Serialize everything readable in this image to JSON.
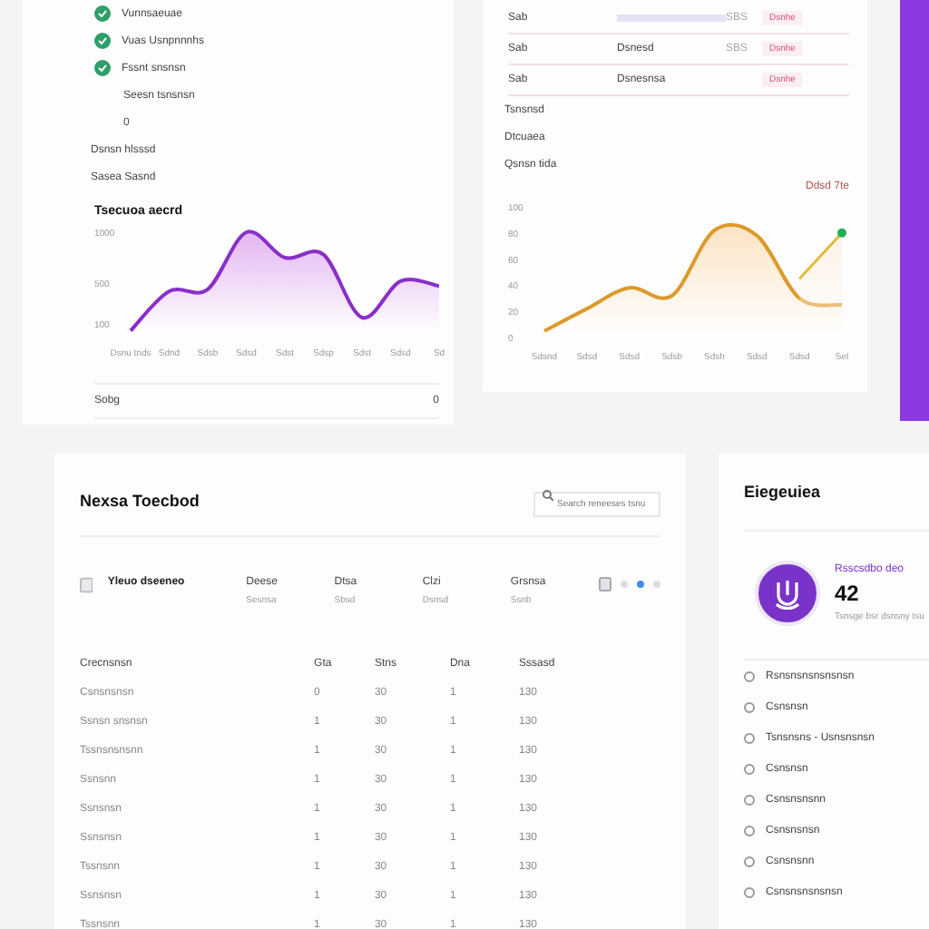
{
  "status_card": {
    "checks": [
      {
        "label": "Vunnsaeuae",
        "done": true
      },
      {
        "label": "Vuas Usnpnnnhs",
        "done": true
      },
      {
        "label": "Fssnt snsnsn",
        "done": true
      }
    ],
    "lines": [
      "Seesn tsnsnsn",
      "0",
      "Dsnsn hlsssd",
      "Sasea Sasnd"
    ],
    "chart": {
      "chart_data": {
        "type": "area",
        "title": "Tsecuoa aecrd",
        "categories": [
          "Dsnu tnds",
          "Sdnd",
          "Sdsb",
          "Sdsd",
          "Sdst",
          "Sdsp",
          "Sdst",
          "Sdsd",
          "Sd"
        ],
        "ylim": [
          0,
          1000
        ],
        "yticks": [
          100,
          500,
          1000
        ],
        "series": [
          {
            "color": "#8a2fc8",
            "values": [
              30,
              420,
              440,
              1000,
              750,
              780,
              160,
              520,
              470
            ]
          }
        ]
      }
    },
    "footer": {
      "label": "Sobg",
      "value": "0"
    }
  },
  "trend_card": {
    "rows": [
      {
        "column_1": "Sab",
        "column_3": "SBS",
        "tag": "Dsnhe"
      },
      {
        "column_1": "Sab",
        "column_2": "Dsnesd",
        "column_3": "SBS",
        "tag": "Dsnhe"
      },
      {
        "column_1": "Sab",
        "column_2": "Dsnesnsa",
        "tag": "Dsnhe"
      }
    ],
    "lines": [
      "Tsnsnsd",
      "Dtcuaea",
      "Qsnsn tida"
    ],
    "chart": {
      "chart_data": {
        "type": "area",
        "categories": [
          "Sdsnd",
          "Sdsd",
          "Sdsd",
          "Sdsb",
          "Sdsh",
          "Sdsd",
          "Sdsd",
          "Sel"
        ],
        "ylim": [
          0,
          100
        ],
        "yticks": [
          0,
          20,
          40,
          60,
          80,
          100
        ],
        "series": [
          {
            "name": "Ddsd 7te",
            "color": "#dd9a2a",
            "values": [
              5,
              22,
              38,
              32,
              82,
              78,
              30,
              25
            ]
          },
          {
            "color": "#e5b93a",
            "values": [
              null,
              null,
              null,
              null,
              null,
              null,
              45,
              80
            ]
          }
        ]
      }
    }
  },
  "table_card": {
    "title": "Nexsa Toecbod",
    "search": {
      "placeholder": "Search reneeses tsnu"
    },
    "summary": {
      "title": "Yleuo dseeneo",
      "stats": [
        {
          "label": "Deese",
          "value": "Sesnsa"
        },
        {
          "label": "Dtsa",
          "value": "Sbsd"
        },
        {
          "label": "Clzi",
          "value": "Dsnsd"
        },
        {
          "label": "Grsnsa",
          "value": "Ssnb"
        }
      ],
      "pages": [
        {
          "selected": false
        },
        {
          "selected": true
        },
        {
          "selected": false
        }
      ]
    },
    "columns": [
      "Crecnsnsn",
      "Gta",
      "Stns",
      "Dna",
      "Sssasd"
    ],
    "rows": [
      [
        "Csnsnsnsn",
        "0",
        "30",
        "1",
        "130"
      ],
      [
        "Ssnsn snsnsn",
        "1",
        "30",
        "1",
        "130"
      ],
      [
        "Tssnsnsnsnn",
        "1",
        "30",
        "1",
        "130"
      ],
      [
        "Ssnsnn",
        "1",
        "30",
        "1",
        "130"
      ],
      [
        "Ssnsnsn",
        "1",
        "30",
        "1",
        "130"
      ],
      [
        "Ssnsnsn",
        "1",
        "30",
        "1",
        "130"
      ],
      [
        "Tssnsnn",
        "1",
        "30",
        "1",
        "130"
      ],
      [
        "Ssnsnsn",
        "1",
        "30",
        "1",
        "130"
      ],
      [
        "Tssnsnn",
        "1",
        "30",
        "1",
        "130"
      ]
    ]
  },
  "profile_card": {
    "title": "Eiegeuiea",
    "name": "Rsscsdbo deo",
    "value": "42",
    "caption": "Tsnsge bsr dsnsny tsu",
    "items": [
      "Rsnsnsnsnsnsnsn",
      "Csnsnsn",
      "Tsnsnsns - Usnsnsnsn",
      "Csnsnsn",
      "Csnsnsnsnn",
      "Csnsnsnsn",
      "Csnsnsnn",
      "Csnsnsnsnsnsn"
    ]
  }
}
